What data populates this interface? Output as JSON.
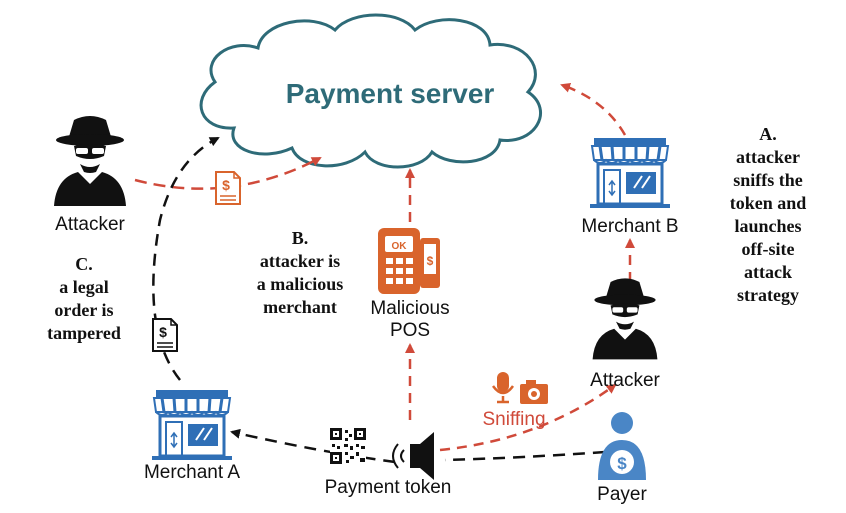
{
  "title": "Payment server",
  "nodes": {
    "attacker_left": "Attacker",
    "attacker_right": "Attacker",
    "merchant_a": "Merchant A",
    "merchant_b": "Merchant B",
    "malicious_pos": [
      "Malicious",
      "POS"
    ],
    "payment_token": "Payment token",
    "payer": "Payer",
    "sniffing": "Sniffing"
  },
  "captions": {
    "a": [
      "A.",
      "attacker",
      "sniffs the",
      "token and",
      "launches",
      "off-site",
      "attack",
      "strategy"
    ],
    "b": [
      "B.",
      "attacker is",
      "a malicious",
      "merchant"
    ],
    "c": [
      "C.",
      "a legal",
      "order is",
      "tampered"
    ]
  },
  "icons": {
    "cloud": "cloud-icon",
    "attacker": "hat-spy-icon",
    "store": "storefront-icon",
    "pos": "pos-terminal-icon",
    "document": "dollar-document-icon",
    "qr": "qr-code-icon",
    "speaker": "sound-wave-speaker-icon",
    "mic": "microphone-icon",
    "camera": "camera-icon",
    "payer": "person-dollar-icon"
  },
  "colors": {
    "title": "#2e6b78",
    "red_arrow": "#d04a3a",
    "orange": "#d9642c",
    "store_blue": "#2f6fb6",
    "payer_blue": "#4a86c6",
    "black": "#111111"
  }
}
